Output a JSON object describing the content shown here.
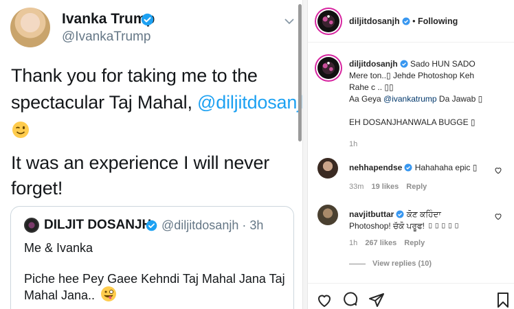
{
  "tweet": {
    "author_name": "Ivanka Trump",
    "author_handle": "@IvankaTrump",
    "line1": "Thank you for taking me to the",
    "line2_prefix": "spectacular Taj Mahal, ",
    "line2_mention": "@diljitdosanjh",
    "line2_suffix": "!",
    "line4": "It was an experience I will never",
    "line5": "forget!",
    "quoted": {
      "author_name": "DILJIT DOSANJH",
      "handle_time": "@diljitdosanjh · 3h",
      "line1": "Me & Ivanka",
      "line2": "Piche hee Pey Gaee Kehndi Taj Mahal Jana Taj",
      "line3": "Mahal Jana.."
    }
  },
  "instagram": {
    "header": {
      "username": "diljitdosanjh",
      "separator": "•",
      "follow_status": "Following"
    },
    "caption": {
      "username": "diljitdosanjh",
      "line1": "Sado HUN SADO",
      "line2": "Mere ton..▯ Jehde Photoshop Keh",
      "line3": "Rahe c .. ▯▯",
      "line4_prefix": "Aa Geya ",
      "line4_mention": "@ivankatrump",
      "line4_suffix": " Da Jawab ▯",
      "line5": "EH DOSANJHANWALA BUGGE ▯",
      "age": "1h"
    },
    "comments": [
      {
        "username": "nehhapendse",
        "text": "Hahahaha epic ▯",
        "age": "33m",
        "likes": "19 likes",
        "reply": "Reply"
      },
      {
        "username": "navjitbuttar",
        "text_line1": "ਕੋਣ ਕਹਿੰਦਾ",
        "text_line2": "Photoshop! ਚੱਕੋ ਪਰੂਫ! ▯▯▯▯▯",
        "age": "1h",
        "likes": "267 likes",
        "reply": "Reply",
        "view_replies": "View replies (10)"
      }
    ],
    "icons": [
      "heart-icon",
      "comment-icon",
      "share-icon",
      "bookmark-icon"
    ],
    "colors": {
      "link": "#00376b",
      "verified": "#3897f0",
      "twitter_blue": "#1da1f2"
    }
  }
}
